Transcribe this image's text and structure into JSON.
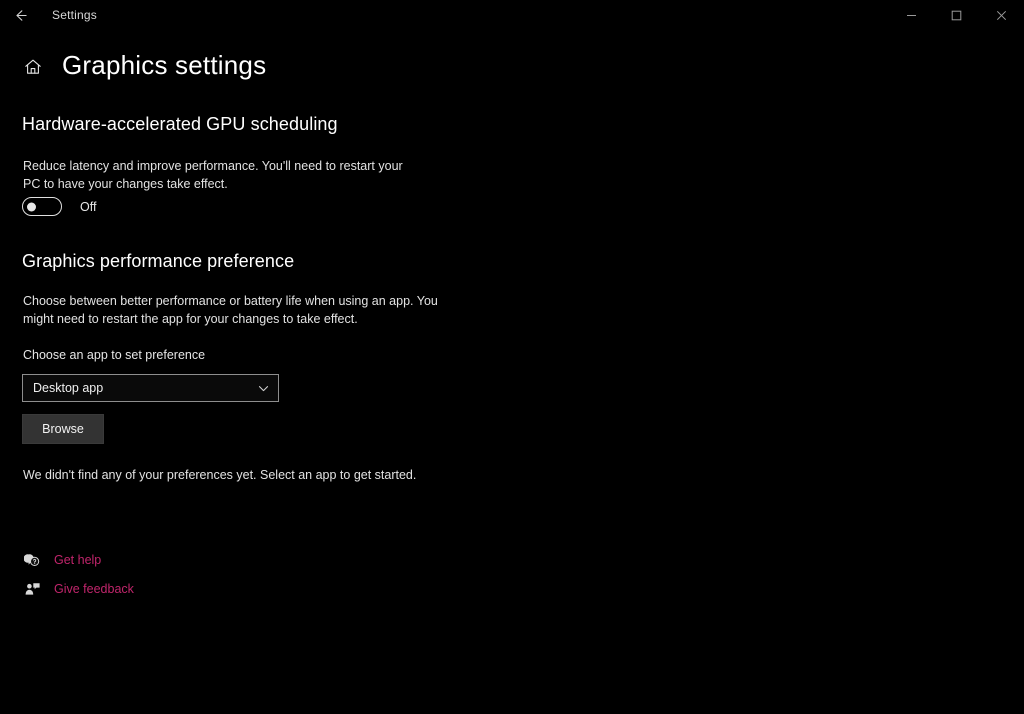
{
  "window": {
    "titlebar": {
      "back_label": "Back",
      "back_icon": "arrow-left-icon",
      "title": "Settings",
      "minimize_label": "Minimize",
      "maximize_label": "Maximize",
      "close_label": "Close"
    },
    "background_color": "#000000"
  },
  "header": {
    "home_icon": "home-icon",
    "title": "Graphics settings"
  },
  "sections": {
    "gpu_scheduling": {
      "heading": "Hardware-accelerated GPU scheduling",
      "description": "Reduce latency and improve performance. You'll need to restart your PC to have your changes take effect.",
      "toggle": {
        "state_label": "Off",
        "checked": false
      }
    },
    "performance_preference": {
      "heading": "Graphics performance preference",
      "description": "Choose between better performance or battery life when using an app. You might need to restart the app for your changes to take effect.",
      "app_picker_label": "Choose an app to set preference",
      "app_picker_value": "Desktop app",
      "app_picker_chevron": "chevron-down-icon",
      "browse_label": "Browse",
      "empty_message": "We didn't find any of your preferences yet. Select an app to get started."
    }
  },
  "footer": {
    "links": [
      {
        "label": "Get help",
        "icon": "help-question-bubble-icon"
      },
      {
        "label": "Give feedback",
        "icon": "feedback-person-icon"
      }
    ],
    "accent_color": "#c0256b"
  }
}
